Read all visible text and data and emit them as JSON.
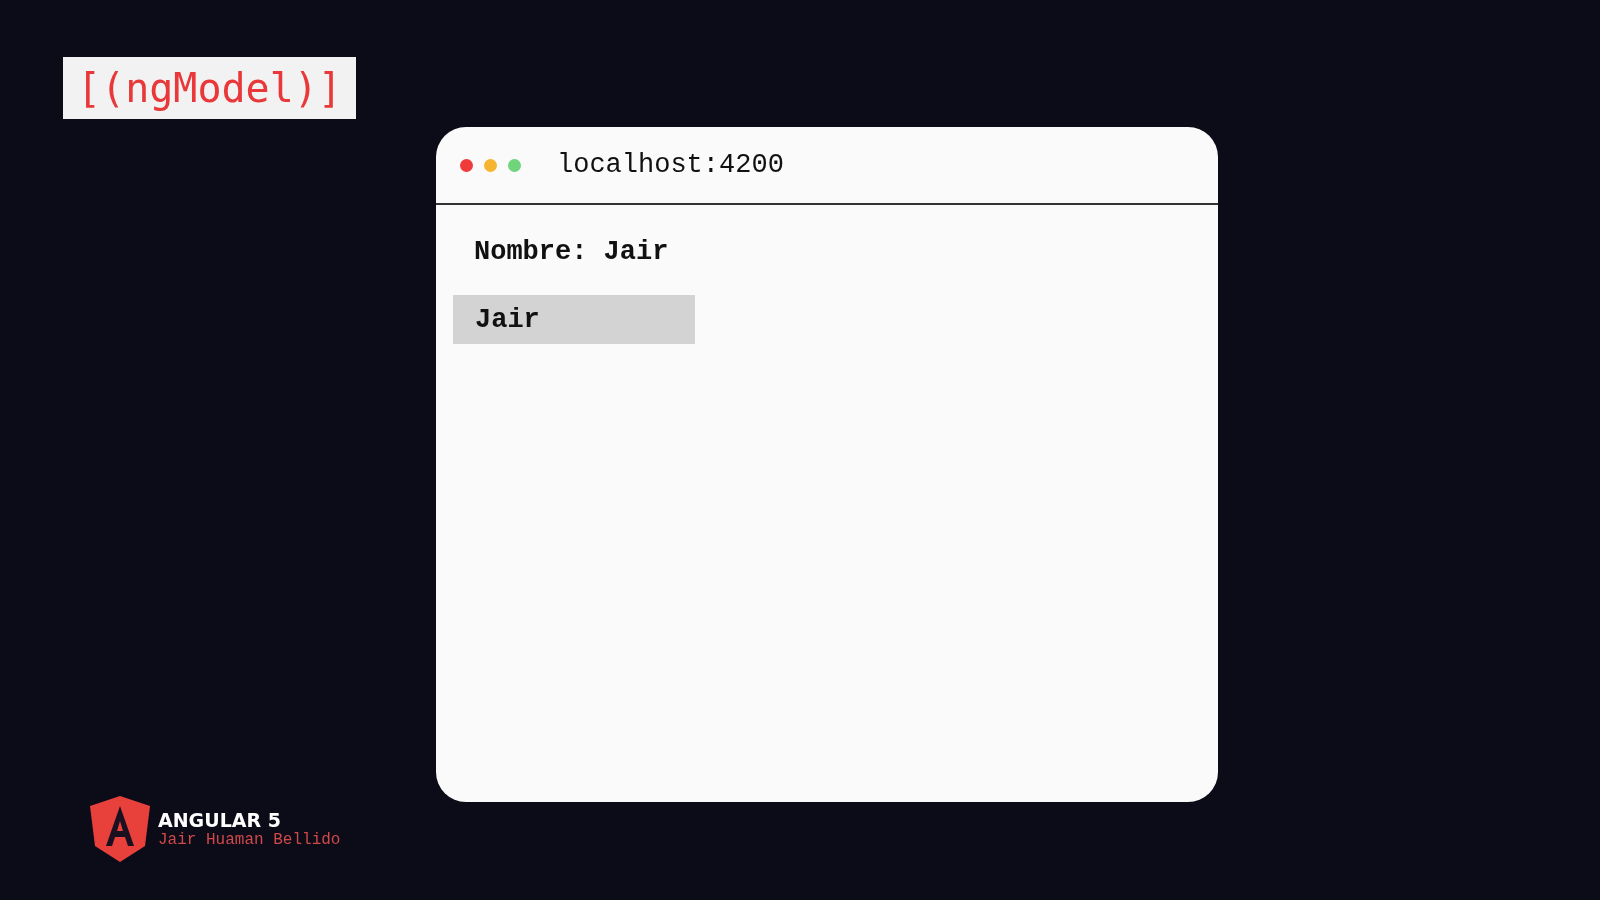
{
  "badge": {
    "text": "[(ngModel)]"
  },
  "browser": {
    "dots": [
      {
        "color": "#ef3b3b"
      },
      {
        "color": "#f5b531"
      },
      {
        "color": "#6fd47a"
      }
    ],
    "address": "localhost:4200",
    "output": "Nombre: Jair",
    "input": {
      "value": "Jair"
    }
  },
  "brand": {
    "title": "ANGULAR 5",
    "author": "Jair Huaman Bellido"
  }
}
